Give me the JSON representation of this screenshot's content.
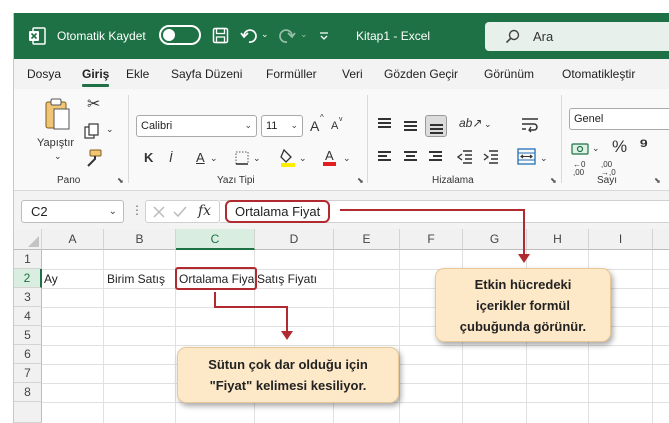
{
  "titlebar": {
    "autosave_label": "Otomatik Kaydet",
    "document_title": "Kitap1  -  Excel",
    "search_placeholder": "Ara"
  },
  "menu": {
    "tabs": [
      "Dosya",
      "Giriş",
      "Ekle",
      "Sayfa Düzeni",
      "Formüller",
      "Veri",
      "Gözden Geçir",
      "Görünüm",
      "Otomatikleştir"
    ],
    "active_tab": "Giriş"
  },
  "ribbon": {
    "clipboard": {
      "paste_label": "Yapıştır",
      "group_label": "Pano"
    },
    "font": {
      "font_name": "Calibri",
      "font_size": "11",
      "bold": "K",
      "italic": "İ",
      "underline": "A",
      "grow": "A",
      "shrink": "A",
      "font_color": "A",
      "group_label": "Yazı Tipi"
    },
    "alignment": {
      "group_label": "Hizalama"
    },
    "number": {
      "format": "Genel",
      "group_label": "Sayı"
    }
  },
  "formula_bar": {
    "name_box": "C2",
    "fx_label": "fx",
    "content": "Ortalama Fiyat"
  },
  "grid": {
    "columns": [
      "A",
      "B",
      "C",
      "D",
      "E",
      "F",
      "G",
      "H",
      "I"
    ],
    "active_column": "C",
    "rows": [
      "1",
      "2",
      "3",
      "4",
      "5",
      "6",
      "7",
      "8"
    ],
    "cells": {
      "A2": "Ay",
      "B2": "Birim Satış",
      "C2": "Ortalama Fiyat",
      "D2": "Satış Fiyatı"
    }
  },
  "callouts": {
    "formula_bar_note": [
      "Etkin hücredeki",
      "içerikler formül",
      "çubuğunda görünür."
    ],
    "column_width_note": [
      "Sütun çok dar olduğu için",
      "\"Fiyat\" kelimesi kesiliyor."
    ]
  },
  "colors": {
    "accent_green": "#1e7145",
    "highlight_red": "#b02a2f",
    "callout_fill": "#fde8c8"
  }
}
